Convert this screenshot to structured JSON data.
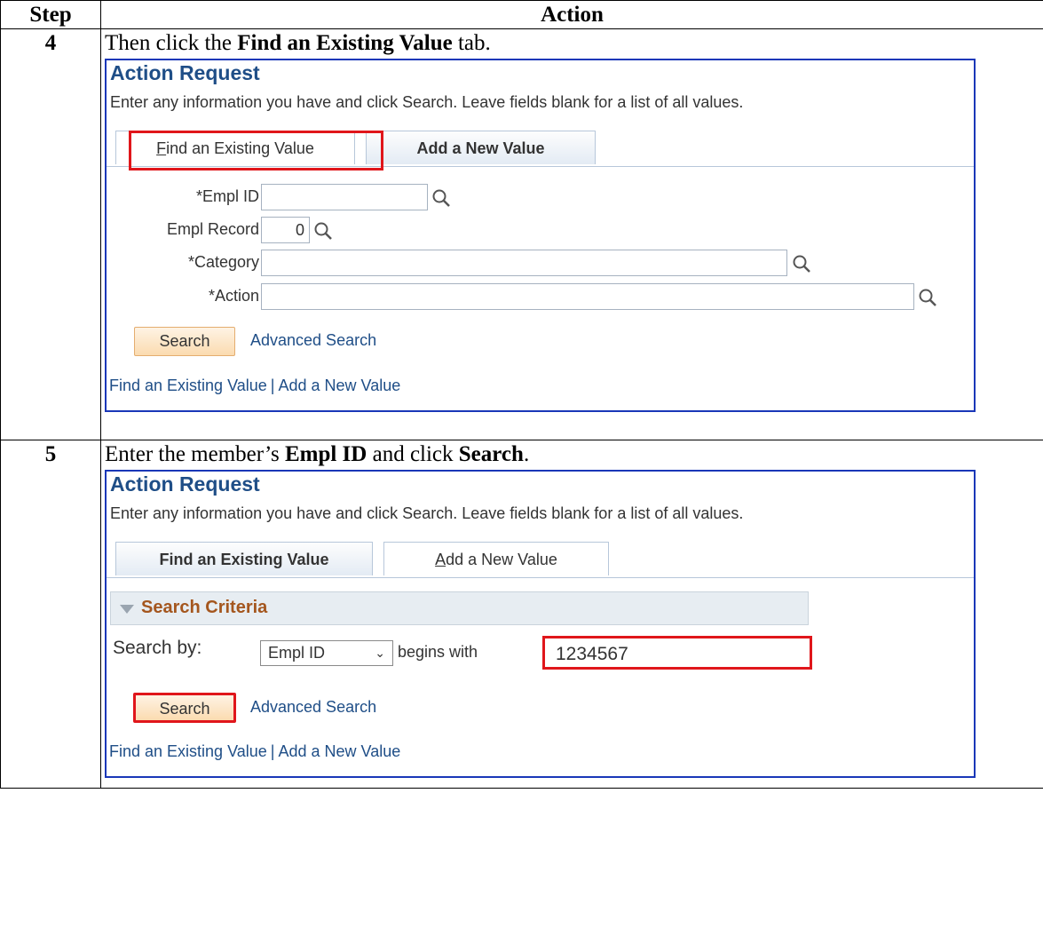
{
  "table": {
    "col_step": "Step",
    "col_action": "Action"
  },
  "step4": {
    "number": "4",
    "instruction_pre": "Then click the ",
    "instruction_bold": "Find an Existing Value",
    "instruction_post": " tab.",
    "screen": {
      "title": "Action Request",
      "description": "Enter any information you have and click Search. Leave fields blank for a list of all values.",
      "tab_find": "Find an Existing Value",
      "tab_add": "Add a New Value",
      "fields": {
        "empl_id_label": "*Empl ID",
        "empl_id_value": "",
        "empl_record_label": "Empl Record",
        "empl_record_value": "0",
        "category_label": "*Category",
        "category_value": "",
        "action_label": "*Action",
        "action_value": ""
      },
      "search_button": "Search",
      "advanced_search": "Advanced Search",
      "footer_find": "Find an Existing Value",
      "footer_sep": "|",
      "footer_add": "Add a New Value"
    }
  },
  "step5": {
    "number": "5",
    "instruction_pre": "Enter the member’s ",
    "instruction_bold1": "Empl ID",
    "instruction_mid": " and click ",
    "instruction_bold2": "Search",
    "instruction_post": ".",
    "screen": {
      "title": "Action Request",
      "description": "Enter any information you have and click Search. Leave fields blank for a list of all values.",
      "tab_find": "Find an Existing Value",
      "tab_add": "Add a New Value",
      "criteria_header": "Search Criteria",
      "search_by_label": "Search by:",
      "search_by_selected": "Empl ID",
      "operator": "begins with",
      "search_value": "1234567",
      "search_button": "Search",
      "advanced_search": "Advanced Search",
      "footer_find": "Find an Existing Value",
      "footer_sep": "|",
      "footer_add": "Add a New Value"
    }
  },
  "colors": {
    "highlight": "#e0161b",
    "frame": "#1a37b8",
    "link": "#1f4e87",
    "criteria_header": "#a4561e"
  },
  "icons": [
    "magnifier-lookup-icon",
    "collapse-triangle-icon",
    "chevron-down-icon"
  ]
}
